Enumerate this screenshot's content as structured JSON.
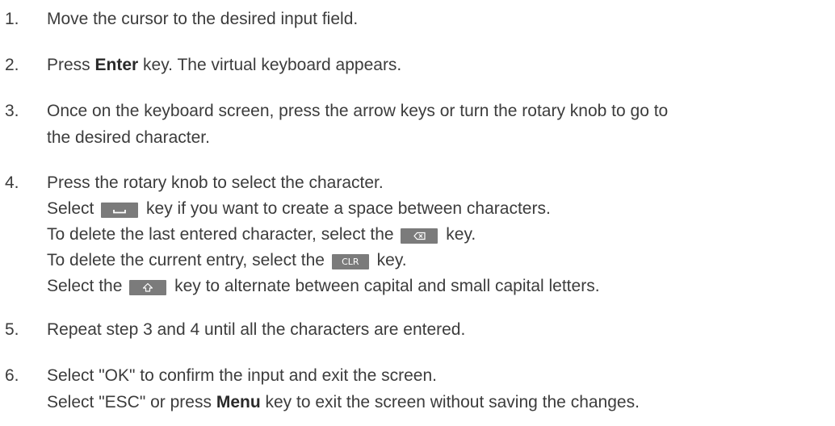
{
  "steps": [
    {
      "number": "1.",
      "text": "Move the cursor to the desired input field."
    },
    {
      "number": "2.",
      "pre": "Press ",
      "bold": "Enter",
      "post": " key. The virtual keyboard appears."
    },
    {
      "number": "3.",
      "line1": "Once on the keyboard screen, press the arrow keys or turn the rotary knob to go to",
      "line2": "the desired character."
    },
    {
      "number": "4.",
      "line1": "Press the rotary knob to select the character.",
      "space_pre": "Select ",
      "space_post": " key if you want to create a space between characters.",
      "bksp_pre": "To delete the last entered character, select the ",
      "bksp_post": " key.",
      "clr_pre": "To delete the current entry, select the ",
      "clr_label": "CLR",
      "clr_post": " key.",
      "shift_pre": "Select the ",
      "shift_post": " key to alternate between capital and small capital letters."
    },
    {
      "number": "5.",
      "text": "Repeat step 3 and 4 until all the characters are entered."
    },
    {
      "number": "6.",
      "line1": "Select \"OK\" to confirm the input and exit the screen.",
      "esc_pre": "Select \"ESC\" or press ",
      "esc_bold": "Menu",
      "esc_post": " key to exit the screen without saving the changes."
    }
  ],
  "icons": {
    "space_key": "space-bar-icon",
    "backspace_key": "backspace-icon",
    "clr_key": "clear-key-icon",
    "shift_key": "shift-arrow-icon"
  },
  "colors": {
    "text": "#3c3c3c",
    "key_background": "#7b7b7b",
    "key_glyph": "#ffffff"
  }
}
